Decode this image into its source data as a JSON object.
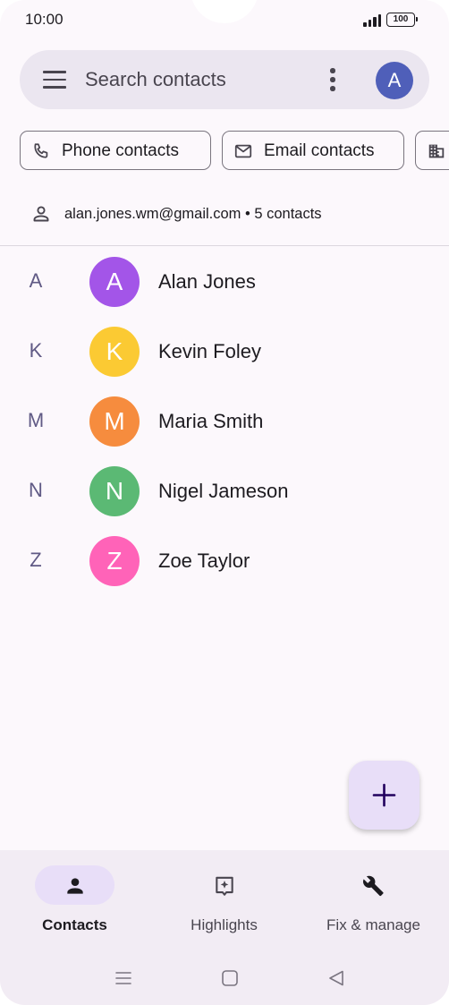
{
  "status_bar": {
    "time": "10:00",
    "battery": "100"
  },
  "search": {
    "placeholder": "Search contacts",
    "account_initial": "A"
  },
  "chips": [
    {
      "label": "Phone contacts",
      "icon": "phone-icon"
    },
    {
      "label": "Email contacts",
      "icon": "mail-icon"
    },
    {
      "label": "",
      "icon": "building-icon"
    }
  ],
  "account": {
    "summary": "alan.jones.wm@gmail.com • 5 contacts",
    "icon": "person-icon"
  },
  "contacts": [
    {
      "index": "A",
      "initial": "A",
      "name": "Alan Jones",
      "color": "#a355e8"
    },
    {
      "index": "K",
      "initial": "K",
      "name": "Kevin Foley",
      "color": "#fbca33"
    },
    {
      "index": "M",
      "initial": "M",
      "name": "Maria Smith",
      "color": "#f68c3e"
    },
    {
      "index": "N",
      "initial": "N",
      "name": "Nigel Jameson",
      "color": "#5bb974"
    },
    {
      "index": "Z",
      "initial": "Z",
      "name": "Zoe Taylor",
      "color": "#ff63b8"
    }
  ],
  "fab": {
    "icon": "plus-icon"
  },
  "bottom_nav": [
    {
      "label": "Contacts",
      "icon": "person-icon",
      "active": true
    },
    {
      "label": "Highlights",
      "icon": "highlights-icon",
      "active": false
    },
    {
      "label": "Fix & manage",
      "icon": "wrench-icon",
      "active": false
    }
  ],
  "colors": {
    "accent": "#e8def8",
    "surface": "#fcf8fc",
    "account_avatar": "#4f5fb9"
  }
}
